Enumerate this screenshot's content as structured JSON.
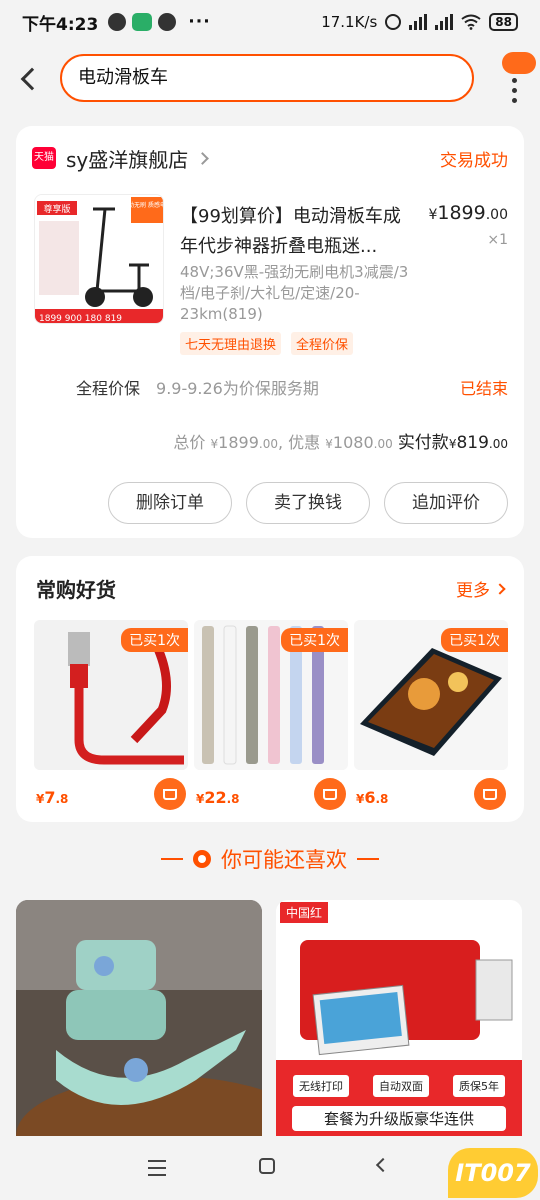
{
  "status_bar": {
    "time": "下午4:23",
    "net_speed": "17.1K/s",
    "battery": "88"
  },
  "search": {
    "query": "电动滑板车"
  },
  "order": {
    "store_name": "sy盛洋旗舰店",
    "store_badge": "天猫",
    "status": "交易成功",
    "product_title": "【99划算价】电动滑板车成年代步神器折叠电瓶迷...",
    "price_symbol": "¥",
    "price_main": "1899",
    "price_dec": ".00",
    "quantity": "×1",
    "spec": "48V;36V黑-强劲无刷电机3减震/3档/电子刹/大礼包/定速/20-23km(819)",
    "tags": [
      "七天无理由退换",
      "全程价保"
    ],
    "price_protect": {
      "label": "全程价保",
      "desc": "9.9-9.26为价保服务期",
      "status": "已结束"
    },
    "total": {
      "total_label": "总价",
      "total_value": "1899",
      "discount_label": ", 优惠",
      "discount_value": "1080",
      "paid_label": "实付款",
      "paid_value": "819",
      "dec": ".00",
      "yen": "¥"
    },
    "actions": [
      "删除订单",
      "卖了换钱",
      "追加评价"
    ],
    "image_text": {
      "top": "尊享版",
      "side": "强劲无刷 质感电机",
      "prices": "1899 900 180 819"
    }
  },
  "frequent": {
    "title": "常购好货",
    "more": "更多",
    "items": [
      {
        "badge": "已买1次",
        "yen": "¥",
        "price": "7",
        "dec": ".8"
      },
      {
        "badge": "已买1次",
        "yen": "¥",
        "price": "22",
        "dec": ".8"
      },
      {
        "badge": "已买1次",
        "yen": "¥",
        "price": "6",
        "dec": ".8"
      }
    ]
  },
  "recommend": {
    "title": "你可能还喜欢",
    "right_item": {
      "label": "中国红",
      "features": [
        "无线打印",
        "自动双面",
        "质保5年"
      ],
      "banner": "套餐为升级版豪华连供"
    }
  },
  "watermark": "IT007",
  "colors": {
    "accent": "#ff5000",
    "badge": "#ff6a1a",
    "tmall": "#ff0036"
  }
}
